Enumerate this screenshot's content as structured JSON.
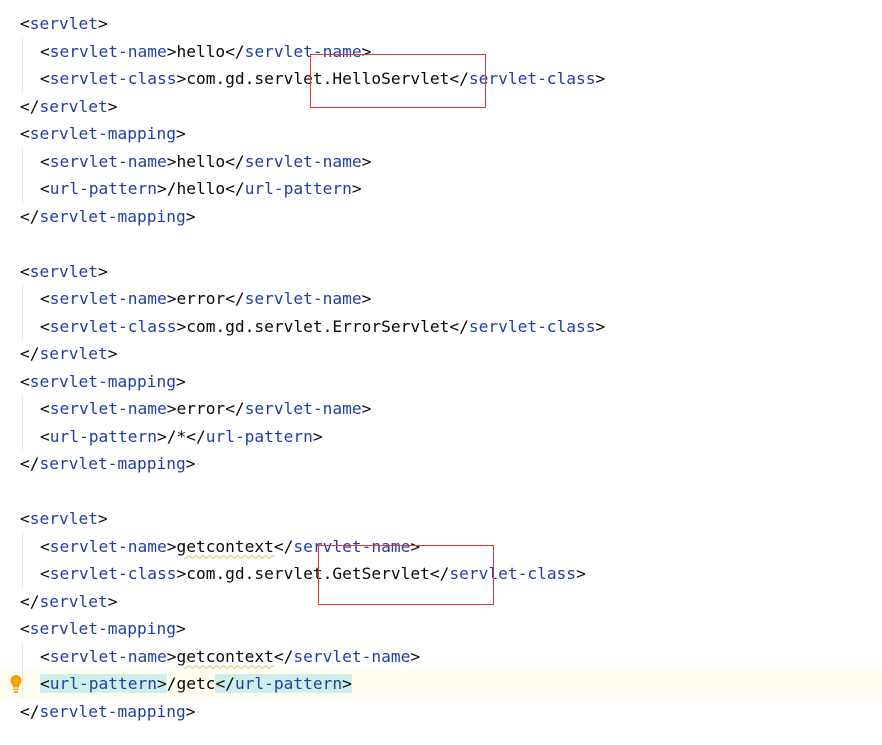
{
  "colors": {
    "tag": "#1f3fa6",
    "text": "#080808",
    "caret_line_bg": "#fefcee",
    "tag_match_bg": "#cdeee9",
    "annotation_border": "#e0393e",
    "bulb": "#f0a30a"
  },
  "icons": {
    "intention_action": "lightbulb-icon"
  },
  "lines": [
    {
      "type": "open",
      "indent": 0,
      "tag": "servlet"
    },
    {
      "type": "elem",
      "indent": 1,
      "tag": "servlet-name",
      "value": "hello"
    },
    {
      "type": "elem",
      "indent": 1,
      "tag": "servlet-class",
      "value": "com.gd.servlet.HelloServlet"
    },
    {
      "type": "close",
      "indent": 0,
      "tag": "servlet"
    },
    {
      "type": "open",
      "indent": 0,
      "tag": "servlet-mapping"
    },
    {
      "type": "elem",
      "indent": 1,
      "tag": "servlet-name",
      "value": "hello"
    },
    {
      "type": "elem",
      "indent": 1,
      "tag": "url-pattern",
      "value": "/hello"
    },
    {
      "type": "close",
      "indent": 0,
      "tag": "servlet-mapping"
    },
    {
      "type": "blank"
    },
    {
      "type": "open",
      "indent": 0,
      "tag": "servlet"
    },
    {
      "type": "elem",
      "indent": 1,
      "tag": "servlet-name",
      "value": "error"
    },
    {
      "type": "elem",
      "indent": 1,
      "tag": "servlet-class",
      "value": "com.gd.servlet.ErrorServlet"
    },
    {
      "type": "close",
      "indent": 0,
      "tag": "servlet"
    },
    {
      "type": "open",
      "indent": 0,
      "tag": "servlet-mapping"
    },
    {
      "type": "elem",
      "indent": 1,
      "tag": "servlet-name",
      "value": "error"
    },
    {
      "type": "elem",
      "indent": 1,
      "tag": "url-pattern",
      "value": "/*"
    },
    {
      "type": "close",
      "indent": 0,
      "tag": "servlet-mapping"
    },
    {
      "type": "blank"
    },
    {
      "type": "open",
      "indent": 0,
      "tag": "servlet"
    },
    {
      "type": "elem",
      "indent": 1,
      "tag": "servlet-name",
      "value": "getcontext",
      "squiggle": true
    },
    {
      "type": "elem",
      "indent": 1,
      "tag": "servlet-class",
      "value": "com.gd.servlet.GetServlet"
    },
    {
      "type": "close",
      "indent": 0,
      "tag": "servlet"
    },
    {
      "type": "open",
      "indent": 0,
      "tag": "servlet-mapping"
    },
    {
      "type": "elem",
      "indent": 1,
      "tag": "servlet-name",
      "value": "getcontext",
      "squiggle": true
    },
    {
      "type": "elem",
      "indent": 1,
      "tag": "url-pattern",
      "value": "/getc",
      "caret_line": true,
      "tag_match": true,
      "bulb": true
    },
    {
      "type": "close",
      "indent": 0,
      "tag": "servlet-mapping"
    }
  ]
}
